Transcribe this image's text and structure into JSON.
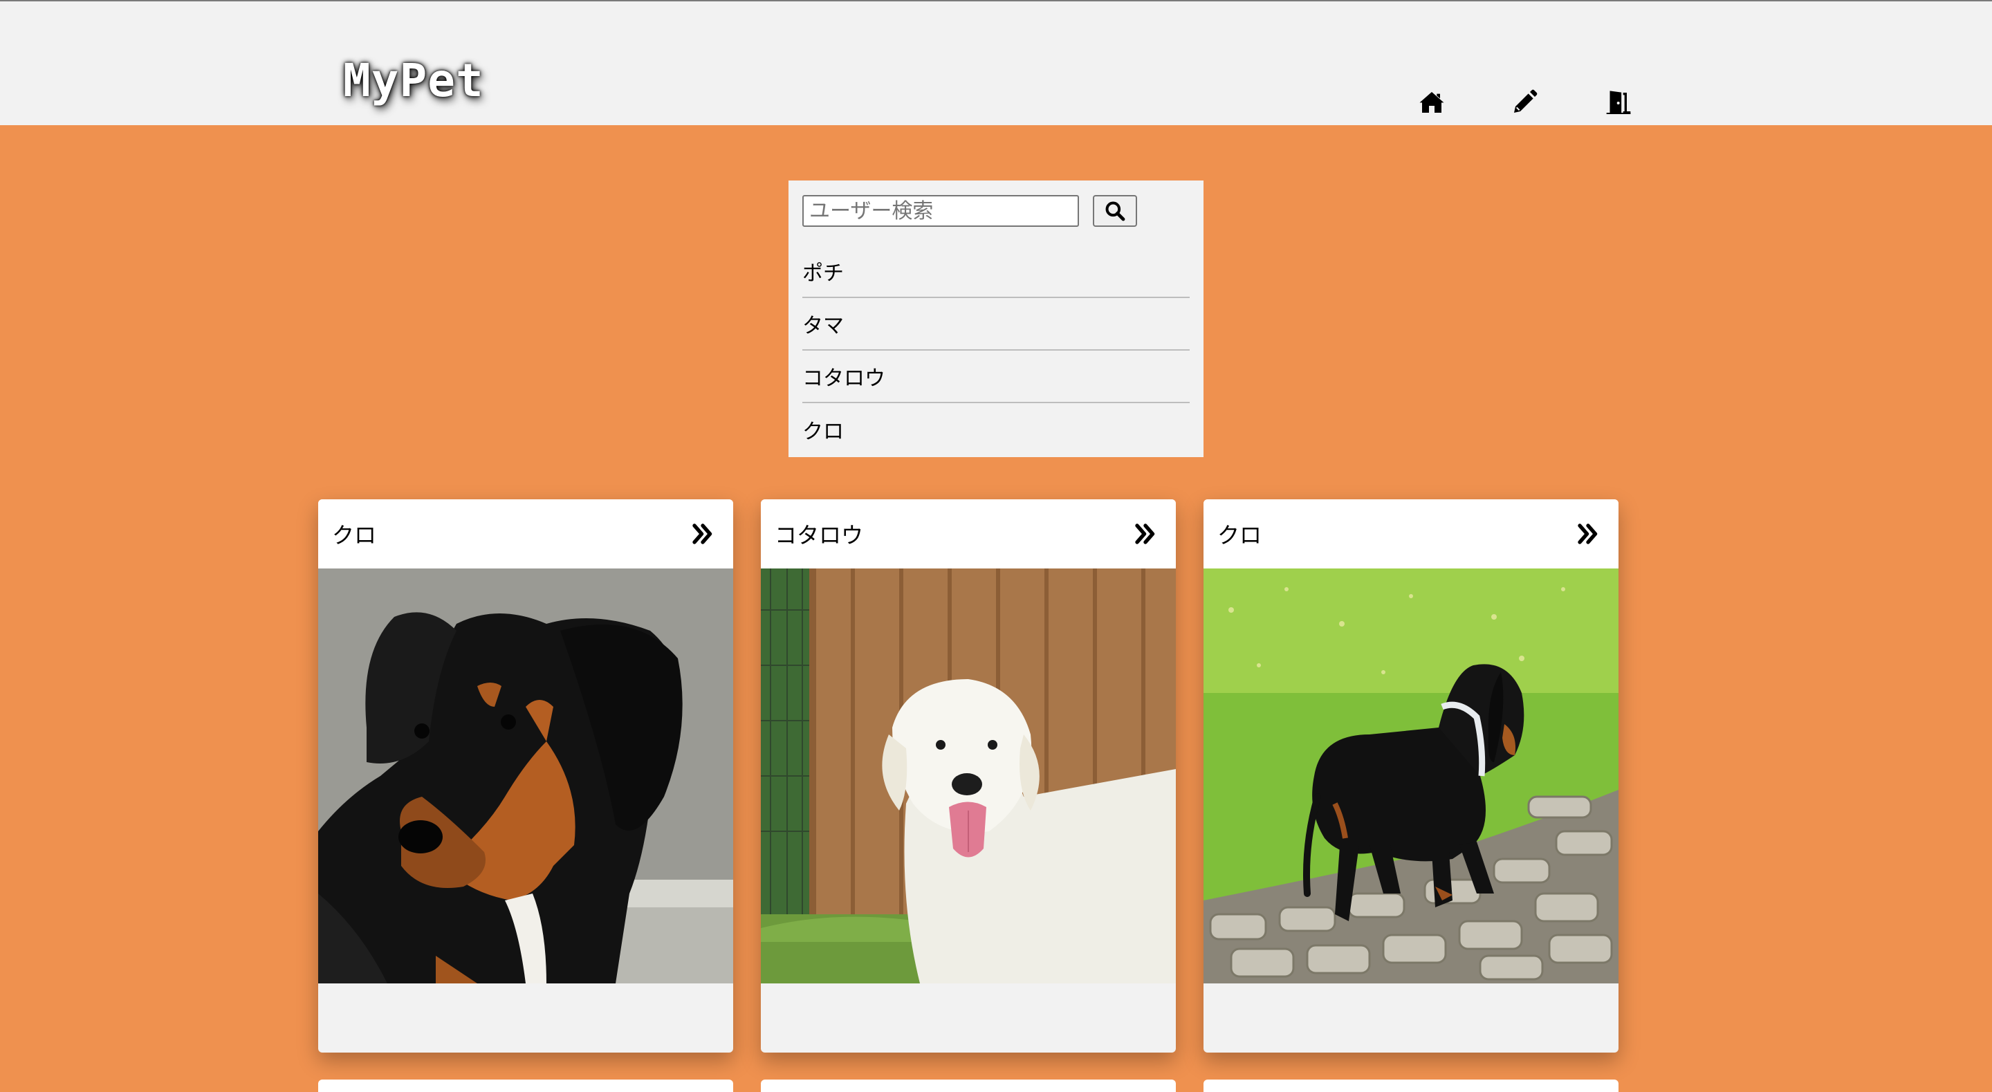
{
  "header": {
    "logo": "MyPet",
    "nav": [
      {
        "name": "home-icon"
      },
      {
        "name": "pencil-icon"
      },
      {
        "name": "logout-door-icon"
      }
    ]
  },
  "search": {
    "placeholder": "ユーザー検索",
    "button_icon": "search-icon",
    "users": [
      "ポチ",
      "タマ",
      "コタロウ",
      "クロ"
    ]
  },
  "cards": [
    {
      "title": "クロ",
      "image": "black-and-tan-dog-portrait",
      "more_icon": "double-chevron-right-icon"
    },
    {
      "title": "コタロウ",
      "image": "white-golden-retriever",
      "more_icon": "double-chevron-right-icon"
    },
    {
      "title": "クロ",
      "image": "dachshund-walking-on-path",
      "more_icon": "double-chevron-right-icon"
    }
  ],
  "colors": {
    "page_background": "#ef914f",
    "header_background": "#f2f2f2",
    "card_header": "#ffffff"
  }
}
